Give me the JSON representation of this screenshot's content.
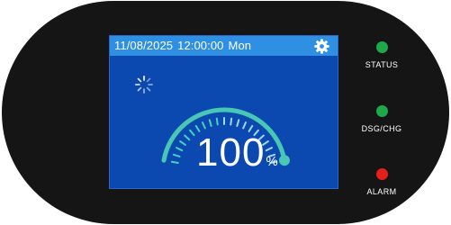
{
  "header": {
    "date": "11/08/2025",
    "time": "12:00:00",
    "day": "Mon"
  },
  "gauge": {
    "level_percent": 100,
    "value": "100",
    "unit": "%"
  },
  "indicators": [
    {
      "label": "STATUS",
      "color": "#1fa84a"
    },
    {
      "label": "DSG/CHG",
      "color": "#1fa84a"
    },
    {
      "label": "ALARM",
      "color": "#e3201b"
    }
  ],
  "icons": {
    "settings": "gear-icon",
    "charging": "loading-spinner-icon"
  },
  "colors": {
    "screen_bg": "#0b49b0",
    "status_bar": "#2f8fe3",
    "gauge_arc": "#47c7b4",
    "device_body": "#151515"
  }
}
